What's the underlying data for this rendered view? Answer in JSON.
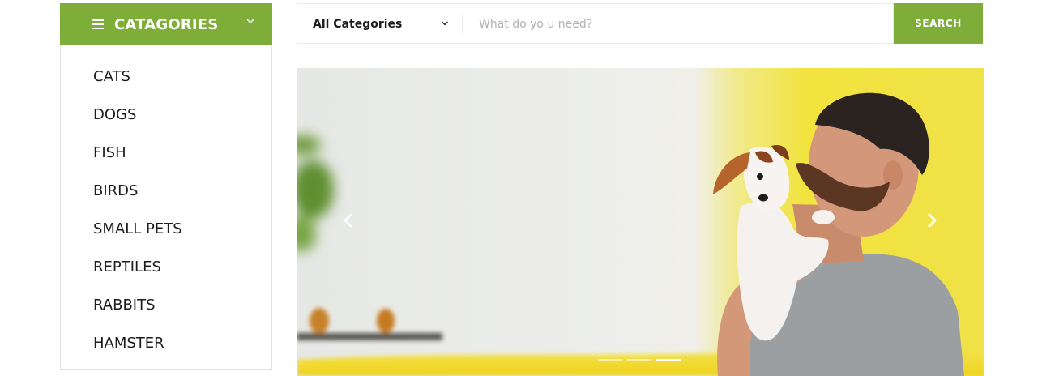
{
  "categories": {
    "title": "CATAGORIES",
    "items": [
      {
        "label": "CATS"
      },
      {
        "label": "DOGS"
      },
      {
        "label": "FISH"
      },
      {
        "label": "BIRDS"
      },
      {
        "label": "SMALL PETS"
      },
      {
        "label": "REPTILES"
      },
      {
        "label": "RABBITS"
      },
      {
        "label": "HAMSTER"
      }
    ]
  },
  "search": {
    "category_label": "All Categories",
    "placeholder": "What do yo u need?",
    "value": "",
    "button_label": "SEARCH"
  },
  "hero": {
    "slide_count": 3,
    "active_slide": 3
  },
  "theme": {
    "accent": "#7fad39",
    "text": "#1c1c1c",
    "placeholder": "#b2b2b2"
  }
}
